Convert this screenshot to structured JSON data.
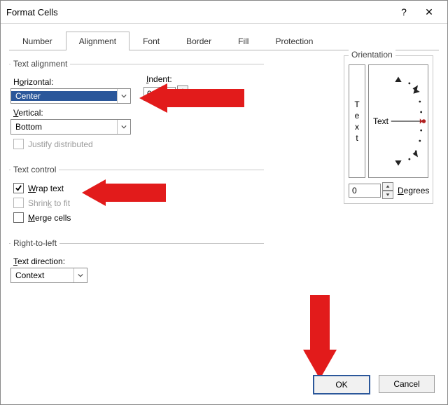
{
  "title": "Format Cells",
  "titlebar": {
    "help": "?",
    "close": "✕"
  },
  "tabs": {
    "number": "Number",
    "alignment": "Alignment",
    "font": "Font",
    "border": "Border",
    "fill": "Fill",
    "protection": "Protection"
  },
  "sections": {
    "text_alignment": "Text alignment",
    "text_control": "Text control",
    "rtl": "Right-to-left",
    "orientation": "Orientation"
  },
  "labels": {
    "horizontal_pre": "H",
    "horizontal_u": "o",
    "horizontal_post": "rizontal:",
    "indent_u": "I",
    "indent_post": "ndent:",
    "vertical_u": "V",
    "vertical_post": "ertical:",
    "text_direction_u": "T",
    "text_direction_post": "ext direction:",
    "degrees_u": "D",
    "degrees_post": "egrees"
  },
  "values": {
    "horizontal": "Center",
    "vertical": "Bottom",
    "indent": "0",
    "text_direction": "Context",
    "degrees": "0",
    "orientation_text": "Text"
  },
  "checks": {
    "justify_distributed": "Justify distributed",
    "wrap_u": "W",
    "wrap_post": "rap text",
    "shrink_post": "Shrin",
    "shrink_u": "k",
    "shrink_tail": " to fit",
    "merge_u": "M",
    "merge_post": "erge cells"
  },
  "buttons": {
    "ok": "OK",
    "cancel": "Cancel"
  },
  "vtext": {
    "t": "T",
    "e": "e",
    "x": "x",
    "t2": "t"
  }
}
